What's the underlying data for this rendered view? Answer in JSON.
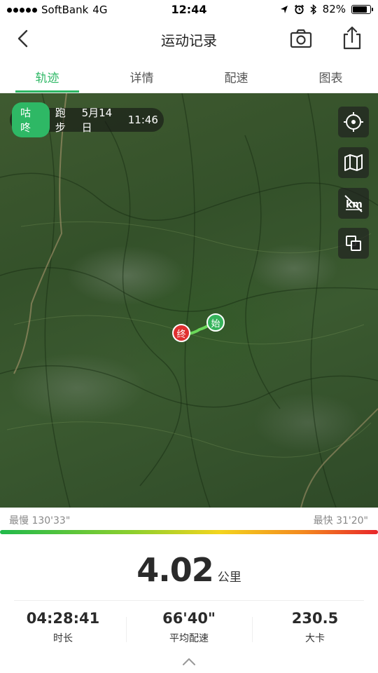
{
  "status_bar": {
    "carrier": "SoftBank",
    "network": "4G",
    "time": "12:44",
    "battery": "82%",
    "battery_level": 0.82
  },
  "nav": {
    "title": "运动记录"
  },
  "tabs": [
    {
      "label": "轨迹",
      "active": true
    },
    {
      "label": "详情",
      "active": false
    },
    {
      "label": "配速",
      "active": false
    },
    {
      "label": "图表",
      "active": false
    }
  ],
  "map": {
    "brand": "咕咚",
    "activity": "跑步",
    "date": "5月14日",
    "time": "11:46",
    "start_marker": "始",
    "end_marker": "终",
    "controls": [
      "locate-icon",
      "map-layer-icon",
      "km-off-icon",
      "layers-icon"
    ]
  },
  "pace": {
    "slowest": "最慢 130'33\"",
    "fastest": "最快 31'20\""
  },
  "summary": {
    "distance": "4.02",
    "distance_unit": "公里",
    "stats": [
      {
        "value": "04:28:41",
        "label": "时长"
      },
      {
        "value": "66'40\"",
        "label": "平均配速"
      },
      {
        "value": "230.5",
        "label": "大卡"
      }
    ]
  },
  "colors": {
    "accent": "#2eb865",
    "end_marker": "#e03030",
    "start_marker": "#35b35b"
  }
}
